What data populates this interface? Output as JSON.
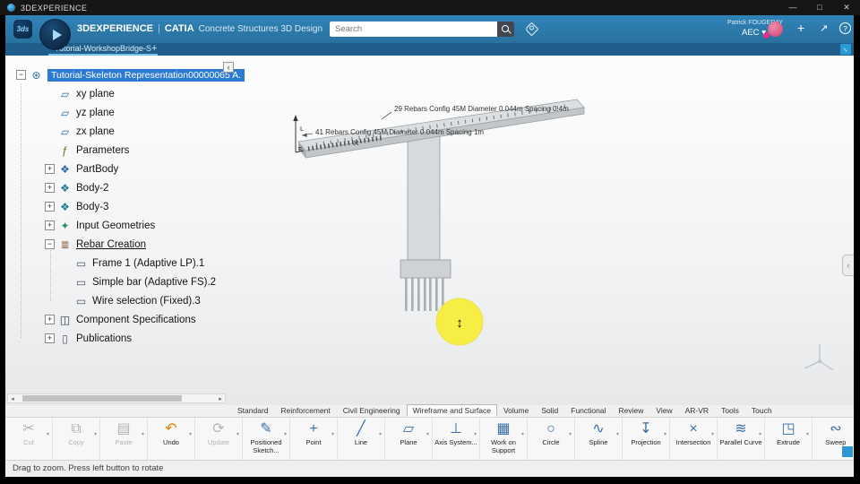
{
  "titlebar": {
    "title": "3DEXPERIENCE",
    "minimize": "—",
    "maximize": "□",
    "close": "✕"
  },
  "header": {
    "brand": "3DEXPERIENCE",
    "separator": "|",
    "app_name": "CATIA",
    "app_desc": "Concrete Structures 3D Design",
    "search_placeholder": "Search",
    "user_name": "Patrick FOUGERAY",
    "workspace": "AEC",
    "workspace_caret": "▾",
    "add_label": "+",
    "help_label": "?"
  },
  "tabbar": {
    "active_tab": "Tutorial-WorkshopBridge-S",
    "new_tab": "+"
  },
  "tree": {
    "root_expand": "−",
    "root_label": "Tutorial-Skeleton Representation00000065 A.",
    "items": [
      {
        "label": "xy plane",
        "level": 1,
        "icon": "plane"
      },
      {
        "label": "yz plane",
        "level": 1,
        "icon": "plane"
      },
      {
        "label": "zx plane",
        "level": 1,
        "icon": "plane"
      },
      {
        "label": "Parameters",
        "level": 1,
        "icon": "parameters"
      },
      {
        "label": "PartBody",
        "level": 1,
        "icon": "partbody",
        "expand": "+"
      },
      {
        "label": "Body-2",
        "level": 1,
        "icon": "body",
        "expand": "+"
      },
      {
        "label": "Body-3",
        "level": 1,
        "icon": "body",
        "expand": "+"
      },
      {
        "label": "Input Geometries",
        "level": 1,
        "icon": "geometry-set",
        "expand": "+"
      },
      {
        "label": "Rebar Creation",
        "level": 1,
        "icon": "rebar-set",
        "expand": "−",
        "underline": true
      },
      {
        "label": "Frame 1 (Adaptive LP).1",
        "level": 2,
        "icon": "rebar"
      },
      {
        "label": "Simple bar (Adaptive FS).2",
        "level": 2,
        "icon": "rebar"
      },
      {
        "label": "Wire selection (Fixed).3",
        "level": 2,
        "icon": "rebar"
      },
      {
        "label": "Component Specifications",
        "level": 1,
        "icon": "component-specs",
        "expand": "+"
      },
      {
        "label": "Publications",
        "level": 1,
        "icon": "publications",
        "expand": "+"
      }
    ]
  },
  "viewport": {
    "annotations": [
      "29 Rebars Config 45M Diameter 0.044m Spacing 0.4m",
      "41 Rebars Config 45M Diameter 0.044m Spacing 1m"
    ],
    "axis": {
      "l": "L",
      "f": "F"
    },
    "cursor": "↕"
  },
  "ribbon_tabs": [
    {
      "label": "Standard"
    },
    {
      "label": "Reinforcement"
    },
    {
      "label": "Civil Engineering"
    },
    {
      "label": "Wireframe and Surface",
      "active": true
    },
    {
      "label": "Volume"
    },
    {
      "label": "Solid"
    },
    {
      "label": "Functional"
    },
    {
      "label": "Review"
    },
    {
      "label": "View"
    },
    {
      "label": "AR-VR"
    },
    {
      "label": "Tools"
    },
    {
      "label": "Touch"
    }
  ],
  "toolbar": [
    {
      "label": "Cut",
      "icon": "cut",
      "glyph": "✂",
      "state": "disabled"
    },
    {
      "label": "Copy",
      "icon": "copy",
      "glyph": "⧉",
      "state": "disabled"
    },
    {
      "label": "Paste",
      "icon": "paste",
      "glyph": "▤",
      "state": "disabled"
    },
    {
      "label": "Undo",
      "icon": "undo",
      "glyph": "↶",
      "state": "orange"
    },
    {
      "label": "Update",
      "icon": "update",
      "glyph": "⟳",
      "state": "disabled"
    },
    {
      "label": "Positioned Sketch...",
      "icon": "positioned-sketch",
      "glyph": "✎"
    },
    {
      "label": "Point",
      "icon": "point",
      "glyph": "+"
    },
    {
      "label": "Line",
      "icon": "line",
      "glyph": "╱"
    },
    {
      "label": "Plane",
      "icon": "plane",
      "glyph": "▱"
    },
    {
      "label": "Axis System...",
      "icon": "axis-system",
      "glyph": "⊥"
    },
    {
      "label": "Work on Support",
      "icon": "work-on-support",
      "glyph": "▦"
    },
    {
      "label": "Circle",
      "icon": "circle",
      "glyph": "○"
    },
    {
      "label": "Spline",
      "icon": "spline",
      "glyph": "∿"
    },
    {
      "label": "Projection",
      "icon": "projection",
      "glyph": "↧"
    },
    {
      "label": "Intersection",
      "icon": "intersection",
      "glyph": "×"
    },
    {
      "label": "Parallel Curve",
      "icon": "parallel-curve",
      "glyph": "≋"
    },
    {
      "label": "Extrude",
      "icon": "extrude",
      "glyph": "◳"
    },
    {
      "label": "Sweep",
      "icon": "sweep",
      "glyph": "∾"
    }
  ],
  "statusbar": {
    "text": "Drag to zoom. Press left button to rotate"
  },
  "colors": {
    "header_blue": "#2c79ad",
    "tab_blue": "#205f8c",
    "selection_blue": "#2d7ad4",
    "highlight_yellow": "#f7ee3b",
    "accent_orange": "#e0820a"
  }
}
